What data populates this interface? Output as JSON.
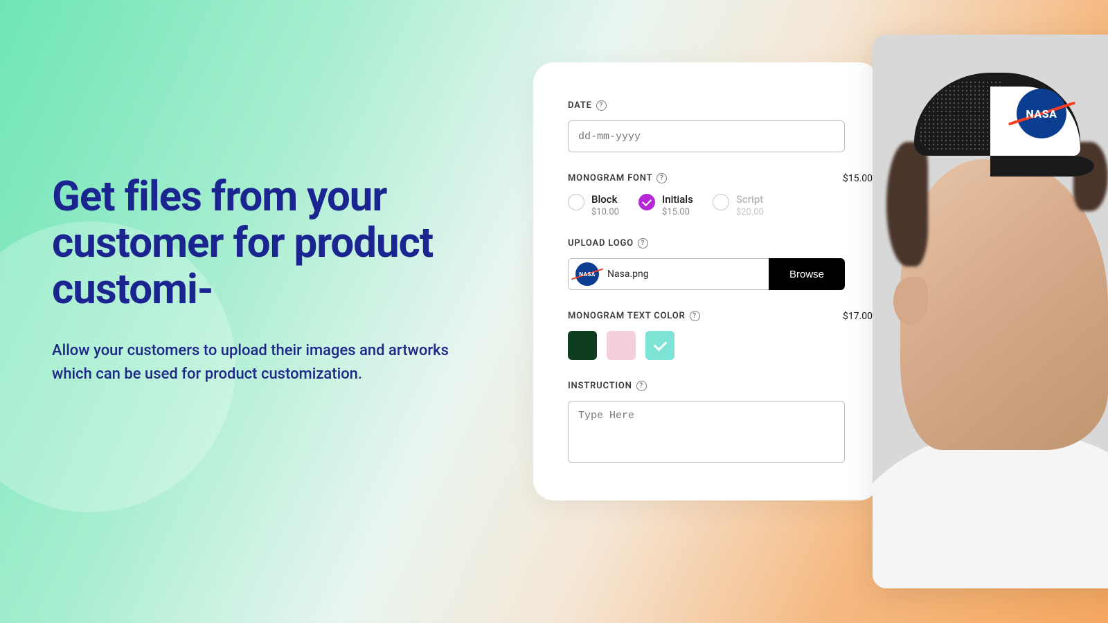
{
  "hero": {
    "title": "Get files from your customer for product customi-",
    "subtitle": "Allow your customers to upload their images and artworks which can be used for product customization."
  },
  "form": {
    "date": {
      "label": "DATE",
      "placeholder": "dd-mm-yyyy"
    },
    "monogram_font": {
      "label": "MONOGRAM FONT",
      "price": "$15.00",
      "options": [
        {
          "label": "Block",
          "price": "$10.00",
          "selected": false,
          "disabled": false
        },
        {
          "label": "Initials",
          "price": "$15.00",
          "selected": true,
          "disabled": false
        },
        {
          "label": "Script",
          "price": "$20.00",
          "selected": false,
          "disabled": true
        }
      ]
    },
    "upload_logo": {
      "label": "UPLOAD LOGO",
      "filename": "Nasa.png",
      "button": "Browse",
      "badge_text": "NASA"
    },
    "text_color": {
      "label": "MONOGRAM TEXT COLOR",
      "price": "$17.00",
      "swatches": [
        {
          "hex": "#0e3d20",
          "selected": false
        },
        {
          "hex": "#f5cfda",
          "selected": false
        },
        {
          "hex": "#7de3d5",
          "selected": true
        }
      ]
    },
    "instruction": {
      "label": "INSTRUCTION",
      "placeholder": "Type Here"
    }
  },
  "product": {
    "cap_logo": "NASA"
  }
}
